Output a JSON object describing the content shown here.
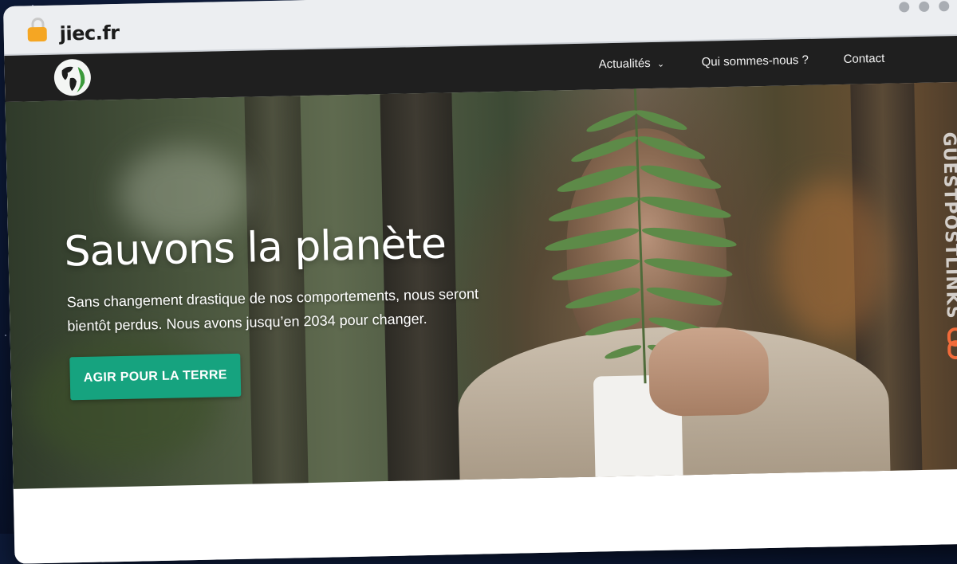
{
  "browser": {
    "url": "jiec.fr"
  },
  "nav": {
    "items": [
      {
        "label": "Actualités"
      },
      {
        "label": "Qui sommes-nous ?"
      },
      {
        "label": "Contact"
      }
    ]
  },
  "hero": {
    "title": "Sauvons la planète",
    "subtitle": "Sans changement drastique de nos comportements, nous seront bientôt perdus. Nous avons jusqu’en 2034 pour changer.",
    "cta_label": "AGIR POUR LA TERRE"
  },
  "watermark": {
    "text": "GUESTPOSTLINKS"
  },
  "colors": {
    "nav_bg": "#1f1f1f",
    "cta_bg": "#16a37f",
    "lock": "#f5a623"
  }
}
